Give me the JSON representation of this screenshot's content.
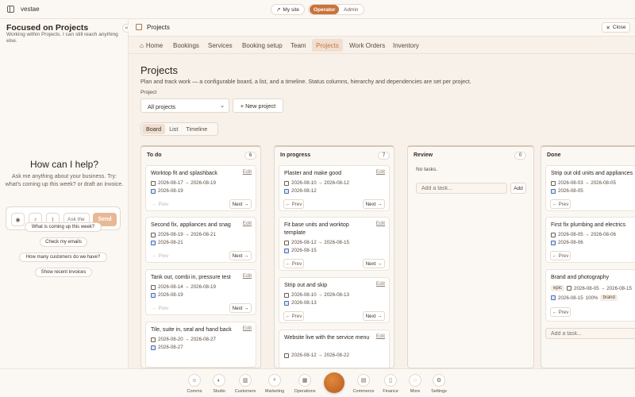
{
  "topbar": {
    "brand": "vestae",
    "my_site": "My site",
    "roles": [
      "Operator",
      "Admin"
    ]
  },
  "assistant": {
    "title": "Focused on Projects",
    "subtitle": "Working within Projects. I can still reach anything else.",
    "heading": "How can I help?",
    "prompt": "Ask me anything about your business. Try: what's coming up this week? or draft an invoice.",
    "input_placeholder": "Ask the assistant…",
    "send_label": "Send",
    "suggestions": [
      "What is coming up this week?",
      "Check my emails",
      "How many customers do we have?",
      "Show recent invoices"
    ]
  },
  "main": {
    "header_title": "Projects",
    "close_label": "Close",
    "nav": [
      "Home",
      "Bookings",
      "Services",
      "Booking setup",
      "Team",
      "Projects",
      "Work Orders",
      "Inventory"
    ],
    "active_nav": "Projects",
    "title": "Projects",
    "description": "Plan and track work — a configurable board, a list, and a timeline. Status columns, hierarchy and dependencies are set per project.",
    "project_label": "Project",
    "project_value": "All projects",
    "new_project": "+ New project",
    "views": [
      "Board",
      "List",
      "Timeline"
    ],
    "active_view": "Board"
  },
  "board": {
    "edit_label": "Edit",
    "prev_label": "← Prev",
    "next_label": "Next →",
    "add_label": "Add",
    "add_placeholder": "Add a task...",
    "no_tasks": "No tasks.",
    "columns": [
      {
        "name": "To do",
        "count": "6",
        "cards": [
          {
            "title": "Worktop fit and splashback",
            "range": "2026-08-17 → 2026-08-19",
            "due": "2026-08-19"
          },
          {
            "title": "Second fix, appliances and snag",
            "range": "2026-08-19 → 2026-08-21",
            "due": "2026-08-21"
          },
          {
            "title": "Tank out, combi in, pressure test",
            "range": "2026-08-14 → 2026-08-19",
            "due": "2026-08-19"
          },
          {
            "title": "Tile, suite in, seal and hand back",
            "range": "2026-08-20 → 2026-08-27",
            "due": "2026-08-27"
          }
        ]
      },
      {
        "name": "In progress",
        "count": "7",
        "cards": [
          {
            "title": "Plaster and make good",
            "range": "2026-08-10 → 2026-08-12",
            "due": "2026-08-12"
          },
          {
            "title": "Fit base units and worktop template",
            "range": "2026-08-12 → 2026-08-15",
            "due": "2026-08-15"
          },
          {
            "title": "Strip out and skip",
            "range": "2026-08-10 → 2026-08-13",
            "due": "2026-08-13"
          },
          {
            "title": "Website live with the service menu",
            "range": "2026-08-12 → 2026-08-22",
            "due": ""
          }
        ]
      },
      {
        "name": "Review",
        "count": "0",
        "cards": []
      },
      {
        "name": "Done",
        "count": "",
        "cards": [
          {
            "title": "Strip out old units and appliances",
            "range": "2026-08-03 → 2026-08-05",
            "due": "2026-08-05"
          },
          {
            "title": "First fix plumbing and electrics",
            "range": "2026-08-05 → 2026-08-06",
            "due": "2026-08-06"
          },
          {
            "title": "Brand and photography",
            "tag": "epic",
            "range": "2026-08-05 → 2026-08-15",
            "due": "2026-08-15",
            "progress": "100%",
            "tag2": "brand"
          }
        ]
      }
    ]
  },
  "dock": [
    "Comms",
    "Studio",
    "Customers",
    "Marketing",
    "Operations",
    "Commerce",
    "Finance",
    "More",
    "Settings"
  ]
}
